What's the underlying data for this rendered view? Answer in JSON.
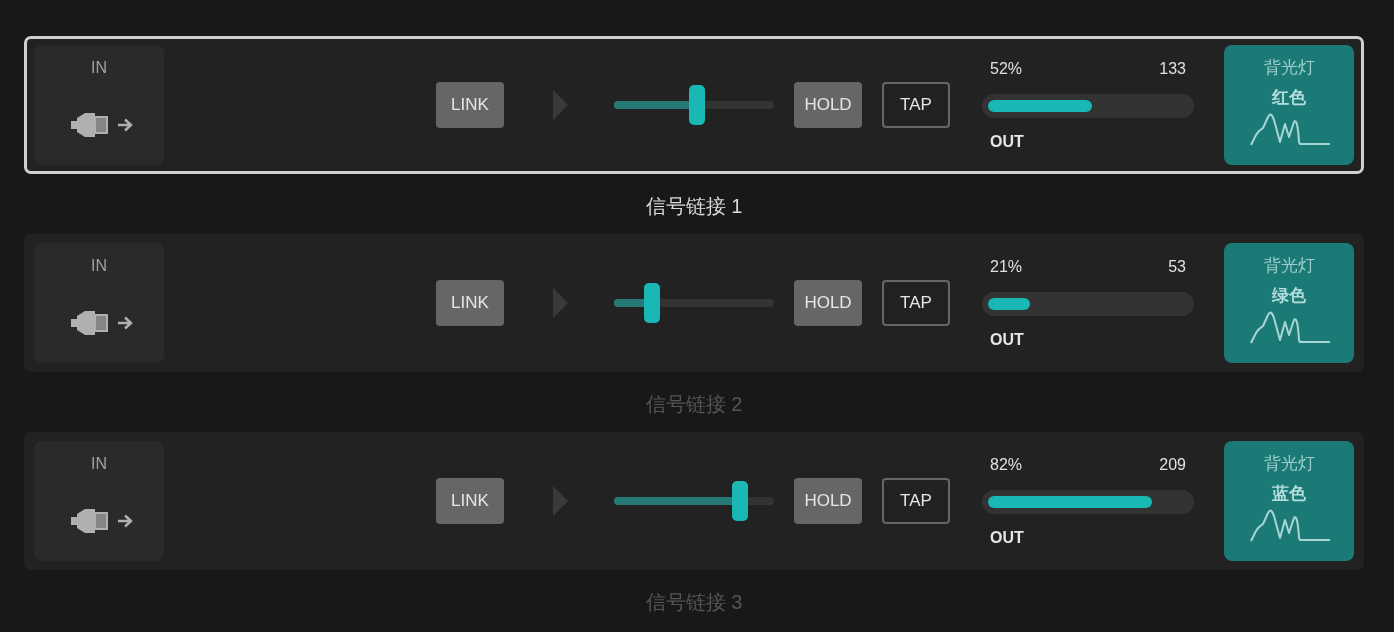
{
  "chains": [
    {
      "selected": true,
      "label": "信号链接 1",
      "input": {
        "label": "IN"
      },
      "link_button": {
        "label": "LINK"
      },
      "slider": {
        "level": 0.52
      },
      "buttons": [
        {
          "kind": "filled",
          "label": "HOLD"
        },
        {
          "kind": "outlined",
          "label": "TAP"
        }
      ],
      "meter": {
        "percent": "52%",
        "value": "133",
        "level": 0.52,
        "label": "OUT"
      },
      "backlight": {
        "title": "背光灯",
        "color_name": "红色"
      }
    },
    {
      "selected": false,
      "label": "信号链接 2",
      "input": {
        "label": "IN"
      },
      "link_button": {
        "label": "LINK"
      },
      "slider": {
        "level": 0.21
      },
      "buttons": [
        {
          "kind": "filled",
          "label": "HOLD"
        },
        {
          "kind": "outlined",
          "label": "TAP"
        }
      ],
      "meter": {
        "percent": "21%",
        "value": "53",
        "level": 0.21,
        "label": "OUT"
      },
      "backlight": {
        "title": "背光灯",
        "color_name": "绿色"
      }
    },
    {
      "selected": false,
      "label": "信号链接 3",
      "input": {
        "label": "IN"
      },
      "link_button": {
        "label": "LINK"
      },
      "slider": {
        "level": 0.82
      },
      "buttons": [
        {
          "kind": "filled",
          "label": "HOLD"
        },
        {
          "kind": "outlined",
          "label": "TAP"
        }
      ],
      "meter": {
        "percent": "82%",
        "value": "209",
        "level": 0.82,
        "label": "OUT"
      },
      "backlight": {
        "title": "背光灯",
        "color_name": "蓝色"
      }
    }
  ]
}
